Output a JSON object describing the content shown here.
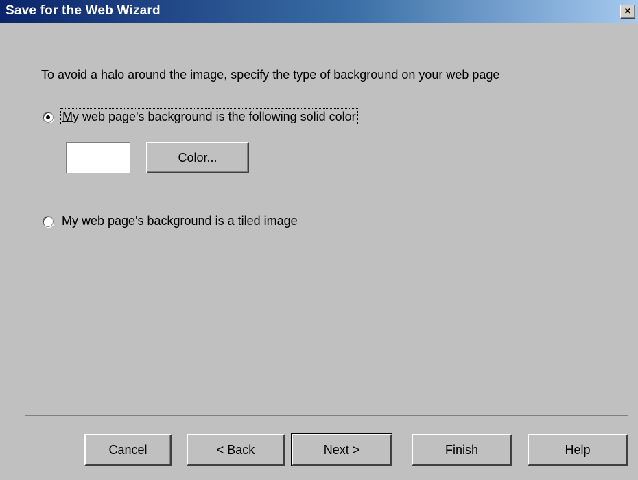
{
  "window": {
    "title": "Save for the Web Wizard",
    "close_glyph": "×"
  },
  "instruction": "To avoid a halo around the image, specify the type of background on your web page",
  "options": {
    "solid": {
      "label_prefix": "",
      "label_mnemonic": "M",
      "label_rest": "y web page's background is the following solid color",
      "selected": true
    },
    "tiled": {
      "label_prefix": "M",
      "label_mnemonic": "y",
      "label_rest": " web page's background is a tiled image",
      "selected": false
    }
  },
  "color": {
    "swatch_value": "#ffffff",
    "button_mnemonic": "C",
    "button_rest": "olor..."
  },
  "buttons": {
    "cancel": {
      "label": "Cancel"
    },
    "back": {
      "prefix": "< ",
      "mnemonic": "B",
      "rest": "ack"
    },
    "next": {
      "prefix": "",
      "mnemonic": "N",
      "rest": "ext >"
    },
    "finish": {
      "prefix": "",
      "mnemonic": "F",
      "rest": "inish"
    },
    "help": {
      "label": "Help"
    }
  }
}
